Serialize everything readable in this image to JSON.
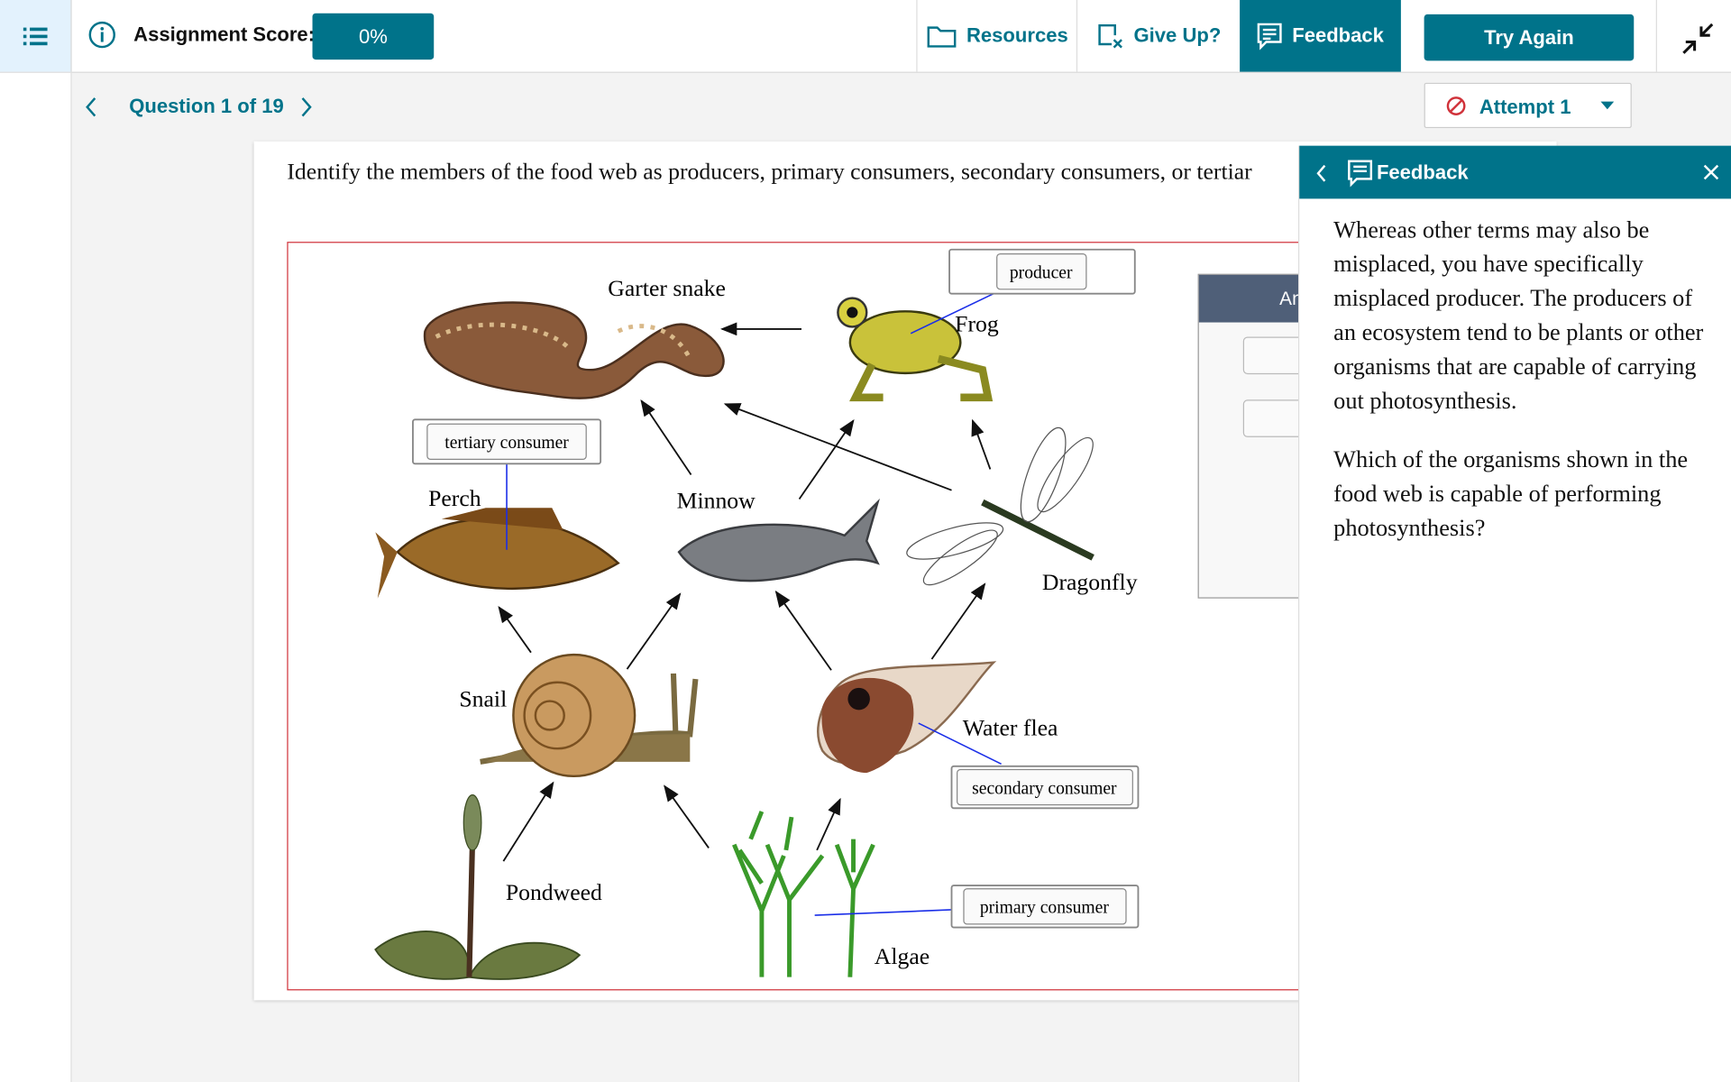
{
  "topbar": {
    "menu_icon": "list-icon",
    "score_label": "Assignment Score:",
    "score_value": "0%",
    "resources": "Resources",
    "give_up": "Give Up?",
    "feedback": "Feedback",
    "try_again": "Try Again"
  },
  "nav": {
    "question": "Question 1 of 19",
    "attempt": "Attempt 1"
  },
  "question": {
    "text": "Identify the members of the food web as producers, primary consumers, secondary consumers, or tertiar"
  },
  "answer_panel": {
    "header": "An"
  },
  "foodweb": {
    "organisms": {
      "snake": "Garter snake",
      "frog": "Frog",
      "perch": "Perch",
      "minnow": "Minnow",
      "dragonfly": "Dragonfly",
      "snail": "Snail",
      "waterflea": "Water flea",
      "pondweed": "Pondweed",
      "algae": "Algae"
    },
    "labels": {
      "producer": "producer",
      "tertiary": "tertiary consumer",
      "secondary": "secondary consumer",
      "primary": "primary consumer"
    }
  },
  "feedback": {
    "title": "Feedback",
    "para1": "Whereas other terms may also be misplaced, you have specifically misplaced producer. The producers of an ecosystem tend to be plants or other organisms that are capable of carrying out photosynthesis.",
    "para2": "Which of the organisms shown in the food web is capable of performing photosynthesis?"
  },
  "colors": {
    "accent": "#00738a",
    "error": "#d0323a",
    "answer_header": "#4f5f78"
  }
}
